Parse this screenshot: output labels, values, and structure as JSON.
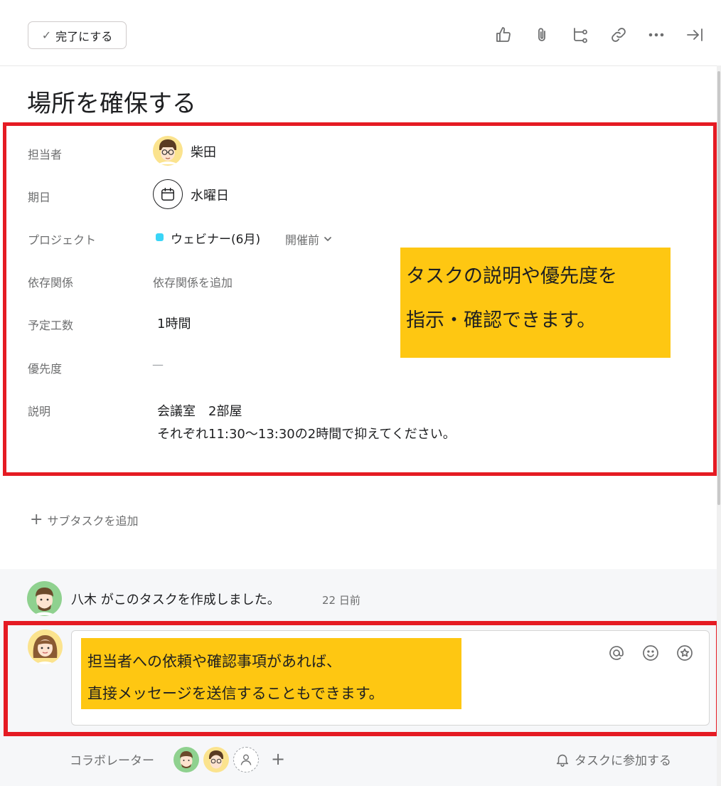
{
  "toolbar": {
    "complete_label": "完了にする",
    "icons": [
      "thumbs-up-icon",
      "paperclip-icon",
      "subtask-icon",
      "link-icon",
      "more-icon",
      "close-pane-icon"
    ]
  },
  "task": {
    "title": "場所を確保する"
  },
  "fields": {
    "assignee": {
      "label": "担当者",
      "value": "柴田"
    },
    "due": {
      "label": "期日",
      "value": "水曜日"
    },
    "project": {
      "label": "プロジェクト",
      "value": "ウェビナー(6月)",
      "section": "開催前",
      "color": "#3ad5f7"
    },
    "dependencies": {
      "label": "依存関係",
      "value": "依存関係を追加"
    },
    "estimate": {
      "label": "予定工数",
      "value": "1時間"
    },
    "priority": {
      "label": "優先度",
      "value": "—"
    },
    "description": {
      "label": "説明",
      "line1": "会議室　2部屋",
      "line2": "それぞれ11:30～13:30の2時間で抑えてください。"
    }
  },
  "callout_top": {
    "line1": "タスクの説明や優先度を",
    "line2": "指示・確認できます。"
  },
  "subtask": {
    "add_label": "サブタスクを追加"
  },
  "activity": {
    "author": "八木",
    "text": " がこのタスクを作成しました。",
    "time": "22 日前"
  },
  "callout_comment": {
    "line1": "担当者への依頼や確認事項があれば、",
    "line2": "直接メッセージを送信することもできます。"
  },
  "footer": {
    "collaborators_label": "コラボレーター",
    "join_label": "タスクに参加する"
  },
  "colors": {
    "highlight_border": "#e51b23",
    "callout_bg": "#fec712",
    "activity_bg": "#f6f7f9"
  }
}
